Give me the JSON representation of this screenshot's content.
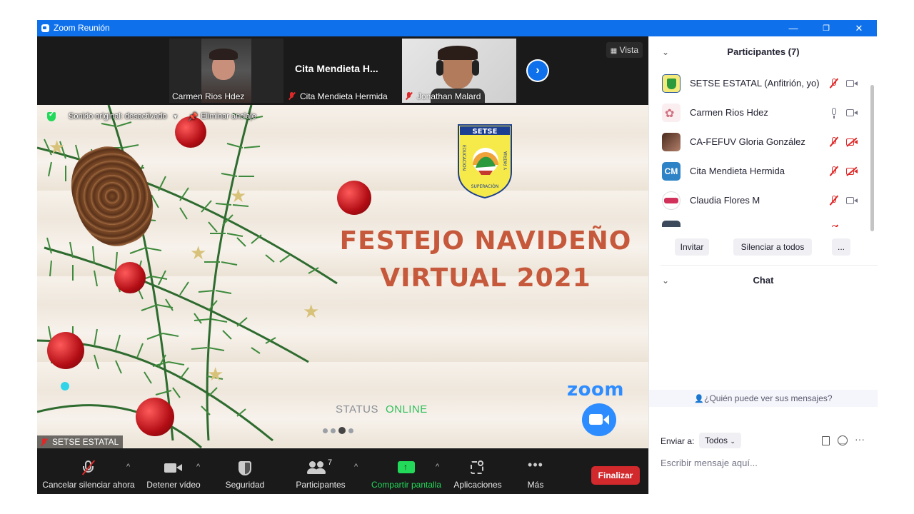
{
  "window": {
    "title": "Zoom Reunión",
    "minimize_icon": "minimize-icon",
    "restore_icon": "restore-icon",
    "close_icon": "close-icon"
  },
  "video_strip": {
    "thumbs": [
      {
        "name": "Carmen Rios Hdez",
        "muted": false
      },
      {
        "name": "Cita Mendieta Hermida",
        "display_title": "Cita  Mendieta  H...",
        "muted": true
      },
      {
        "name": "Jonathan Malard",
        "muted": true
      }
    ],
    "view_label": "Vista"
  },
  "share": {
    "original_sound": "Sonido original: desactivado",
    "unpin": "Eliminar anclaje",
    "logo_text": "SETSE",
    "logo_left": "EDUCACION",
    "logo_right": "Y PATRIA",
    "logo_bottom": "SUPERACIÓN",
    "headline_1": "FESTEJO NAVIDEÑO",
    "headline_2": "VIRTUAL 2021",
    "status_label": "STATUS",
    "status_value": "ONLINE",
    "zoom_logo": "zoom",
    "self_name": "SETSE ESTATAL",
    "carousel_active": 2
  },
  "toolbar": {
    "mute_label": "Cancelar silenciar ahora",
    "video_label": "Detener vídeo",
    "security_label": "Seguridad",
    "participants_label": "Participantes",
    "participants_count": "7",
    "share_label": "Compartir pantalla",
    "apps_label": "Aplicaciones",
    "more_label": "Más",
    "end_label": "Finalizar",
    "colors": {
      "share": "#23d959",
      "end": "#d1292c"
    }
  },
  "participants_panel": {
    "title": "Participantes (7)",
    "people": [
      {
        "name": "SETSE ESTATAL (Anfitrión, yo)",
        "mic": "muted",
        "cam": "on"
      },
      {
        "name": "Carmen Rios Hdez",
        "mic": "on",
        "cam": "on"
      },
      {
        "name": "CA-FEFUV Gloria González",
        "mic": "muted",
        "cam": "off"
      },
      {
        "name": "Cita Mendieta Hermida",
        "initials": "CM",
        "mic": "muted",
        "cam": "off"
      },
      {
        "name": "Claudia Flores M",
        "mic": "muted",
        "cam": "on"
      }
    ],
    "invite_label": "Invitar",
    "mute_all_label": "Silenciar a todos",
    "more_label": "..."
  },
  "chat": {
    "title": "Chat",
    "who_can_see": "¿Quién puede ver sus mensajes?",
    "send_to_label": "Enviar a:",
    "send_to_value": "Todos",
    "input_placeholder": "Escribir mensaje aquí..."
  }
}
